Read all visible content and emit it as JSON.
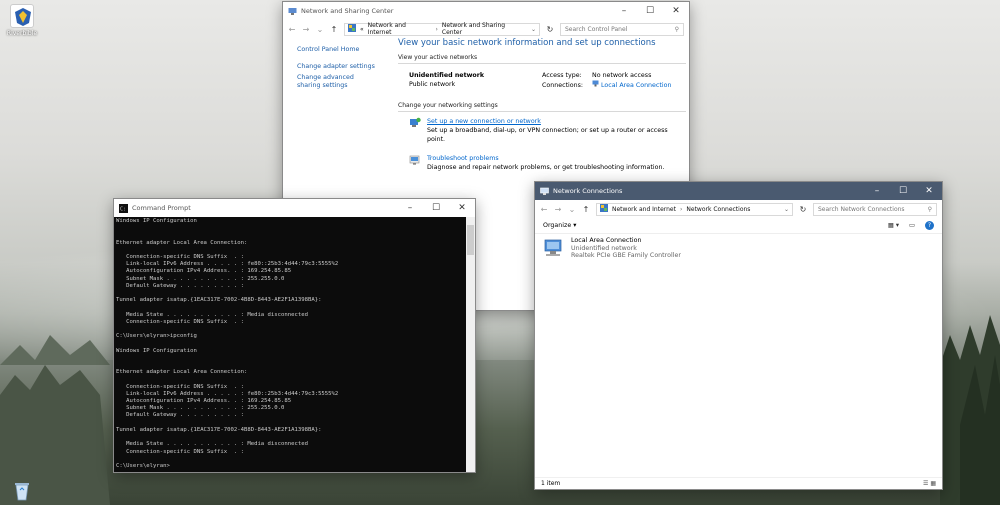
{
  "desktop": {
    "icons": [
      {
        "label": "Riverbible",
        "icon": "app-shield-icon"
      },
      {
        "label": "",
        "icon": "recycle-bin-icon"
      }
    ]
  },
  "nsc": {
    "title": "Network and Sharing Center",
    "breadcrumb": [
      "«",
      "Network and Internet",
      "›",
      "Network and Sharing Center"
    ],
    "search_placeholder": "Search Control Panel",
    "sidebar": [
      "Control Panel Home",
      "Change adapter settings",
      "Change advanced sharing settings"
    ],
    "heading": "View your basic network information and set up connections",
    "active_networks_label": "View your active networks",
    "network_name": "Unidentified network",
    "network_type": "Public network",
    "access_type_label": "Access type:",
    "access_type_value": "No network access",
    "connections_label": "Connections:",
    "connections_value": "Local Area Connection",
    "change_settings_label": "Change your networking settings",
    "tasks": [
      {
        "link": "Set up a new connection or network",
        "desc": "Set up a broadband, dial-up, or VPN connection; or set up a router or access point."
      },
      {
        "link": "Troubleshoot problems",
        "desc": "Diagnose and repair network problems, or get troubleshooting information."
      }
    ]
  },
  "cmd": {
    "title": "Command Prompt",
    "lines": [
      "Windows IP Configuration",
      "",
      "",
      "Ethernet adapter Local Area Connection:",
      "",
      "   Connection-specific DNS Suffix  . :",
      "   Link-local IPv6 Address . . . . . : fe80::25b3:4d44:79c3:5555%2",
      "   Autoconfiguration IPv4 Address. . : 169.254.85.85",
      "   Subnet Mask . . . . . . . . . . . : 255.255.0.0",
      "   Default Gateway . . . . . . . . . :",
      "",
      "Tunnel adapter isatap.{1EAC317E-7002-4B8D-8443-AE2F1A1398BA}:",
      "",
      "   Media State . . . . . . . . . . . : Media disconnected",
      "   Connection-specific DNS Suffix  . :",
      "",
      "C:\\Users\\elyran>ipconfig",
      "",
      "Windows IP Configuration",
      "",
      "",
      "Ethernet adapter Local Area Connection:",
      "",
      "   Connection-specific DNS Suffix  . :",
      "   Link-local IPv6 Address . . . . . : fe80::25b3:4d44:79c3:5555%2",
      "   Autoconfiguration IPv4 Address. . : 169.254.85.85",
      "   Subnet Mask . . . . . . . . . . . : 255.255.0.0",
      "   Default Gateway . . . . . . . . . :",
      "",
      "Tunnel adapter isatap.{1EAC317E-7002-4B8D-8443-AE2F1A1398BA}:",
      "",
      "   Media State . . . . . . . . . . . : Media disconnected",
      "   Connection-specific DNS Suffix  . :",
      "",
      "C:\\Users\\elyran>"
    ]
  },
  "netc": {
    "title": "Network Connections",
    "breadcrumb": [
      "Network and Internet",
      "›",
      "Network Connections"
    ],
    "search_placeholder": "Search Network Connections",
    "organize": "Organize ▾",
    "item": {
      "name": "Local Area Connection",
      "status": "Unidentified network",
      "device": "Realtek PCIe GBE Family Controller"
    },
    "status_bar": "1 item"
  },
  "colors": {
    "link": "#0066cc",
    "heading": "#1e5fa8",
    "netc_titlebar": "#4a5a70"
  }
}
